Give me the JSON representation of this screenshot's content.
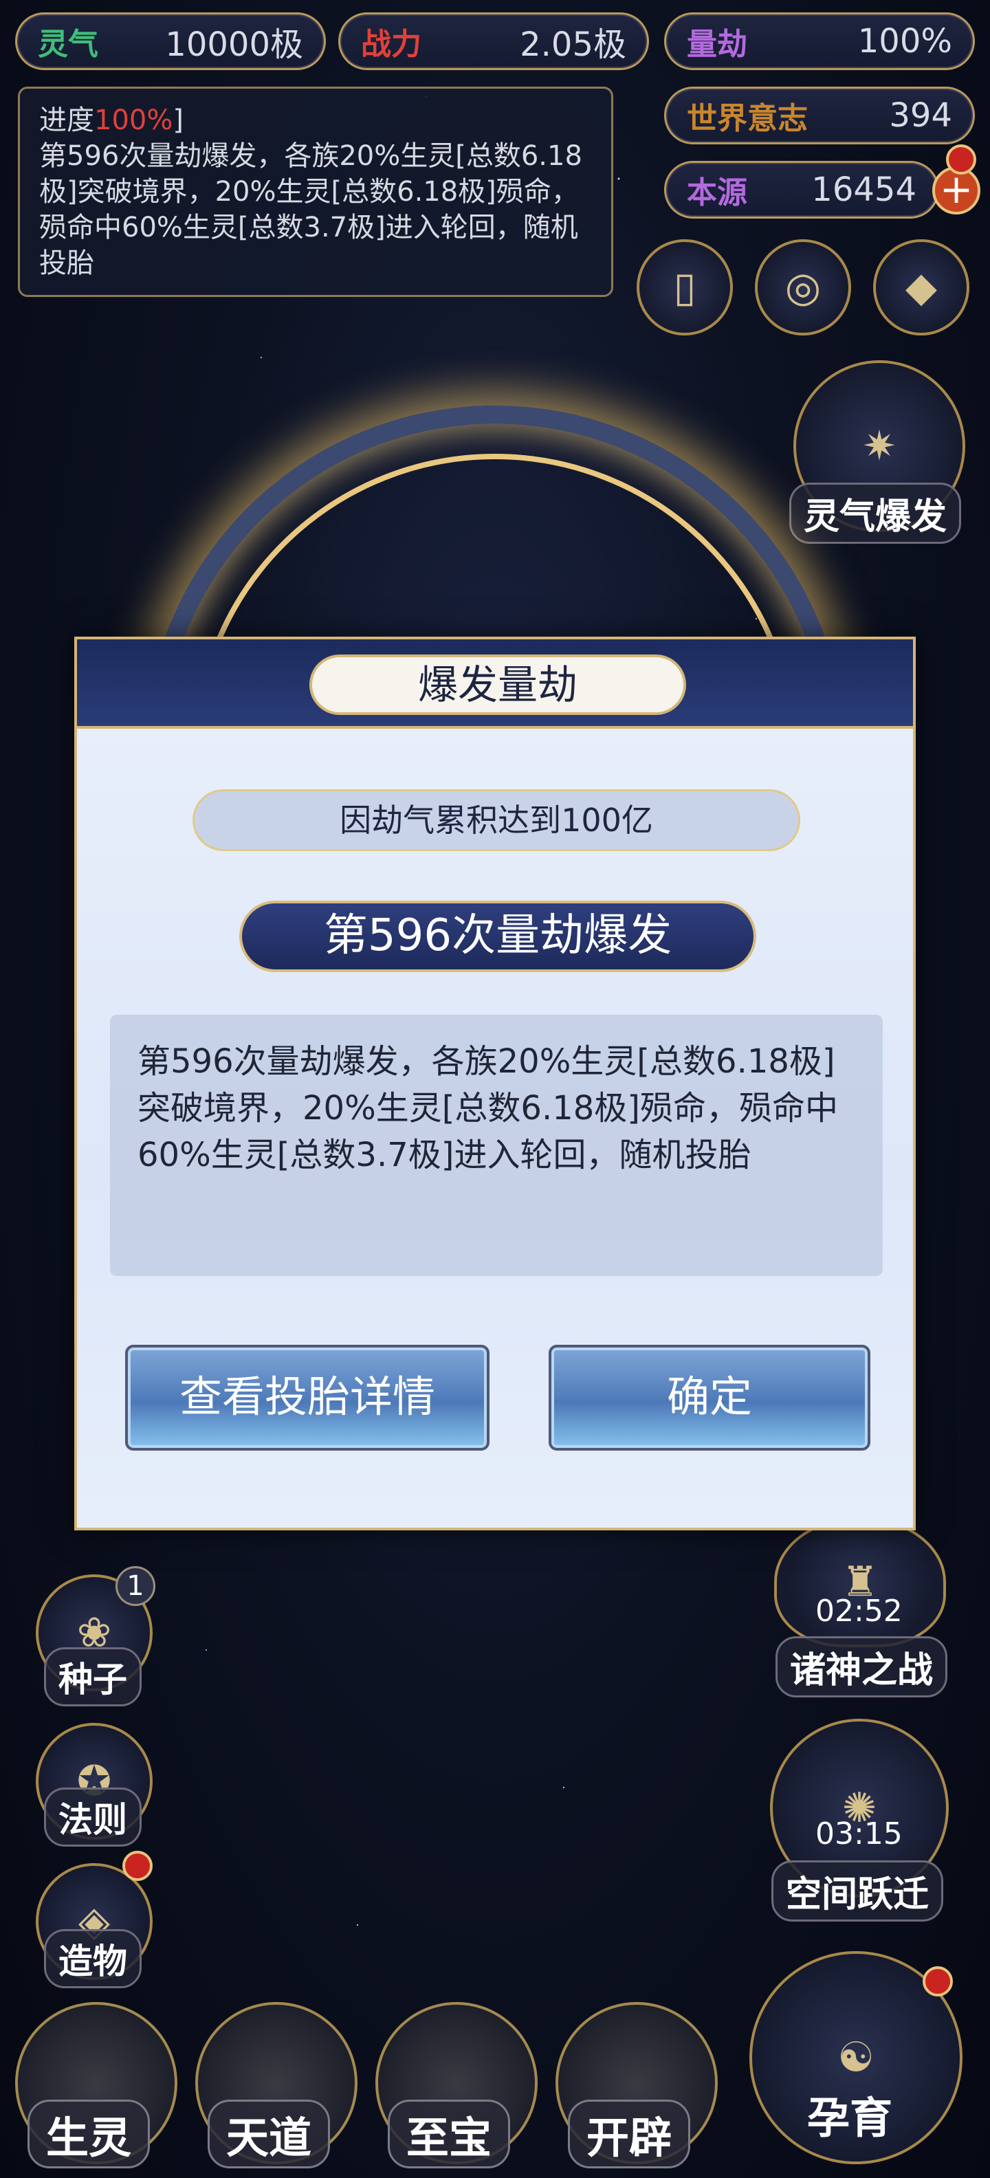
{
  "stats": {
    "lingqi": {
      "label": "灵气",
      "value": "10000极",
      "color": "#3fbf7a"
    },
    "zhanli": {
      "label": "战力",
      "value": "2.05极",
      "color": "#e0413a"
    },
    "liangjie": {
      "label": "量劫",
      "value": "100%",
      "color": "#b46adf"
    },
    "shijie": {
      "label": "世界意志",
      "value": "394",
      "color": "#c9862c"
    },
    "benyuan": {
      "label": "本源",
      "value": "16454",
      "color": "#b46adf"
    },
    "plus": "+"
  },
  "progress": {
    "label": "进度",
    "percent": "100%",
    "bracket": "]",
    "text": "第596次量劫爆发，各族20%生灵[总数6.18极]突破境界，20%生灵[总数6.18极]殒命，殒命中60%生灵[总数3.7极]进入轮回，随机投胎"
  },
  "right_menu": {
    "lingqi_baofa": "灵气爆发",
    "zhushen_timer": "02:52",
    "zhushen": "诸神之战",
    "kongjian_timer": "03:15",
    "kongjian": "空间跃迁",
    "yunyu": "孕育"
  },
  "left_menu": {
    "zhongzi": "种子",
    "zhongzi_badge": "1",
    "faze": "法则",
    "zaowu": "造物"
  },
  "bottom_menu": [
    "生灵",
    "天道",
    "至宝",
    "开辟"
  ],
  "modal": {
    "title": "爆发量劫",
    "reason": "因劫气累积达到100亿",
    "banner": "第596次量劫爆发",
    "detail": "第596次量劫爆发，各族20%生灵[总数6.18极]突破境界，20%生灵[总数6.18极]殒命，殒命中60%生灵[总数3.7极]进入轮回，随机投胎",
    "view_button": "查看投胎详情",
    "confirm_button": "确定"
  }
}
